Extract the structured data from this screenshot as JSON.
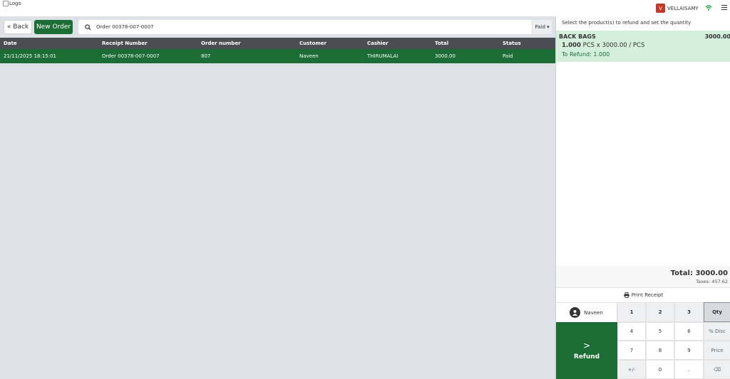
{
  "topbar": {
    "logo_alt": "Logo",
    "user_initial": "V",
    "user_name": "VELLAISAMY"
  },
  "toolbar": {
    "back_label": "« Back",
    "new_order_label": "New Order",
    "search_value": "Order 00378-007-0007",
    "filter_label": "Paid ▾"
  },
  "table": {
    "columns": [
      "Date",
      "Receipt Number",
      "Order number",
      "Customer",
      "Cashier",
      "Total",
      "Status"
    ],
    "rows": [
      [
        "21/11/2025 18:15:01",
        "Order 00378-007-0007",
        "807",
        "Naveen",
        "THIRUMALAI",
        "3000.00",
        "Paid"
      ]
    ]
  },
  "refund_panel": {
    "instructions": "Select the product(s) to refund and set the quantity",
    "product": {
      "name": "BACK BAGS",
      "price": "3000.00",
      "qty": "1.000",
      "qty_detail": "PCS x 3000.00 / PCS",
      "to_refund": "To Refund: 1.000"
    },
    "total": "Total: 3000.00",
    "taxes": "Taxes: 457.62",
    "print_label": "Print Receipt",
    "customer_name": "Naveen",
    "refund_label": "Refund",
    "refund_chevron": ">"
  },
  "keypad": {
    "k1": "1",
    "k2": "2",
    "k3": "3",
    "qty": "Qty",
    "k4": "4",
    "k5": "5",
    "k6": "6",
    "disc": "% Disc",
    "k7": "7",
    "k8": "8",
    "k9": "9",
    "price": "Price",
    "sign": "+/-",
    "k0": "0",
    "dot": ".",
    "back": "⌫"
  },
  "colors": {
    "accent": "#1b6d35",
    "header_dark": "#4a4e53",
    "product_bg": "#d4efdc",
    "pane_bg": "#dee2e6"
  }
}
